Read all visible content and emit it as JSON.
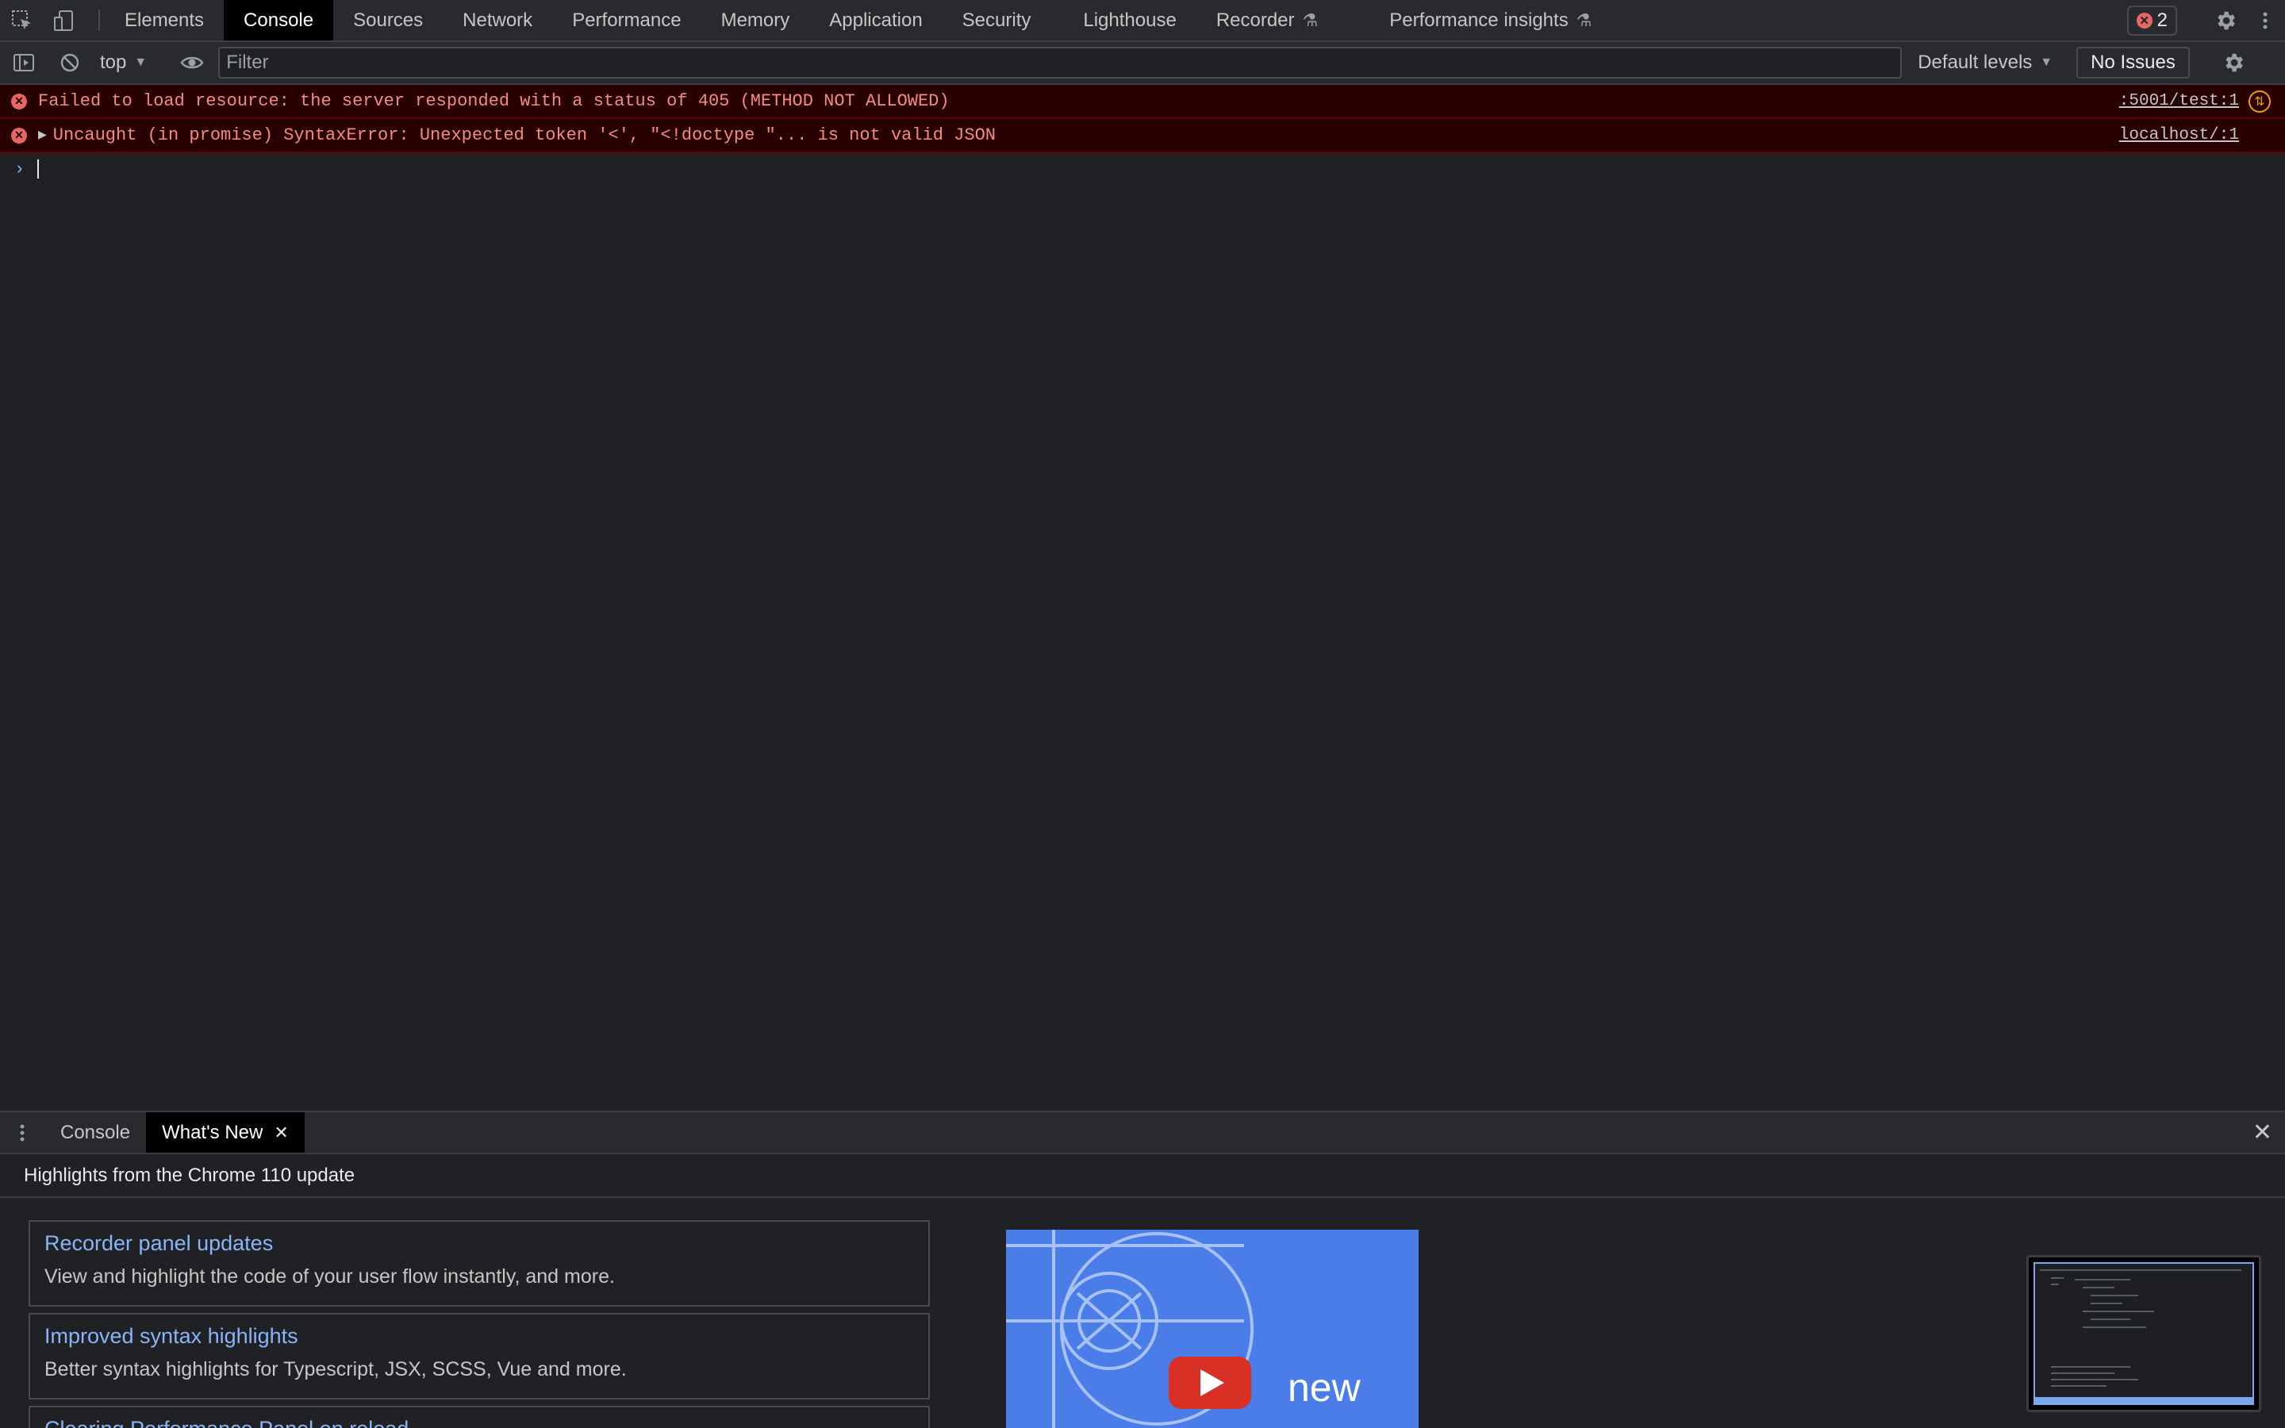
{
  "tabbar": {
    "tabs": [
      "Elements",
      "Console",
      "Sources",
      "Network",
      "Performance",
      "Memory",
      "Application",
      "Security",
      "Lighthouse",
      "Recorder",
      "Performance insights"
    ],
    "error_count": "2"
  },
  "toolbar": {
    "context": "top",
    "filter_placeholder": "Filter",
    "levels": "Default levels",
    "issues": "No Issues"
  },
  "messages": [
    {
      "text": "Failed to load resource: the server responded with a status of 405 (METHOD NOT ALLOWED)",
      "source": ":5001/test:1"
    },
    {
      "text": "Uncaught (in promise) SyntaxError: Unexpected token '<', \"<!doctype \"... is not valid JSON",
      "source": "localhost/:1"
    }
  ],
  "drawer": {
    "tabs": [
      "Console",
      "What's New"
    ],
    "highlights": "Highlights from the Chrome 110 update",
    "cards": [
      {
        "title": "Recorder panel updates",
        "desc": "View and highlight the code of your user flow instantly, and more."
      },
      {
        "title": "Improved syntax highlights",
        "desc": "Better syntax highlights for Typescript, JSX, SCSS, Vue and more."
      },
      {
        "title": "Clearing Performance Panel on reload",
        "desc": ""
      }
    ],
    "video_text": "new"
  },
  "colors": {
    "error_text": "#f28b82",
    "link": "#8ab4f8",
    "error_bg": "#290000"
  }
}
